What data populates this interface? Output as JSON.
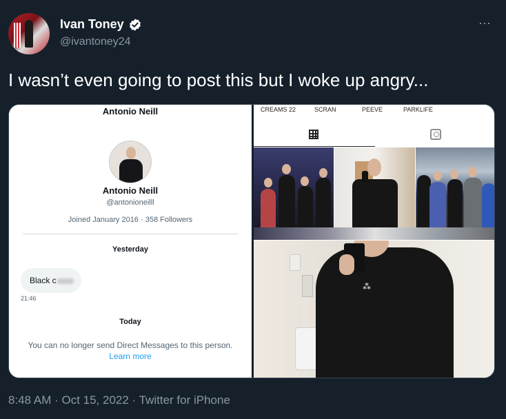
{
  "tweet": {
    "author_name": "Ivan Toney",
    "handle": "@ivantoney24",
    "text": "I wasn’t even going to post this but I woke up angry...",
    "timestamp": "8:48 AM · Oct 15, 2022 · Twitter for iPhone",
    "more_icon": "⋯"
  },
  "dm_screenshot": {
    "header_name": "Antonio Neill",
    "profile_name": "Antonio Neill",
    "profile_handle": "@antonioneilll",
    "joined": "Joined January 2016 · 358 Followers",
    "date_yesterday": "Yesterday",
    "message_text": "Black c",
    "message_time": "21:46",
    "date_today": "Today",
    "notice": "You can no longer send Direct Messages to this person.",
    "learn_more": "Learn more"
  },
  "instagram_screenshot": {
    "highlights": [
      "CREAMS 22",
      "SCRAN",
      "PEEVE",
      "PARKLIFE"
    ],
    "tabs": [
      "grid-icon",
      "tagged-icon"
    ]
  },
  "colors": {
    "background": "#15202b",
    "muted": "#8b98a5",
    "link": "#1d9bf0"
  }
}
